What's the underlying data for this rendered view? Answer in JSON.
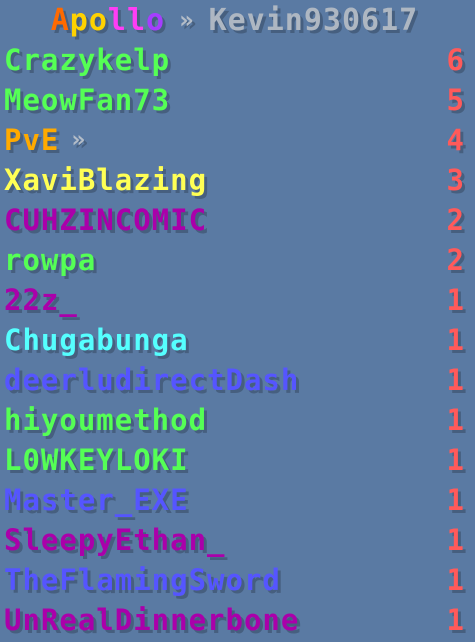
{
  "header": {
    "server": "Apollo",
    "separator": "»",
    "viewer": "Kevin930617",
    "server_gradient": [
      "#ff6a00",
      "#ffd200",
      "#ff3df5",
      "#a63dff"
    ]
  },
  "rows": [
    {
      "name": "Crazykelp",
      "score": "6",
      "color": "#55ff55"
    },
    {
      "name": "MeowFan73",
      "score": "5",
      "color": "#55ff55"
    },
    {
      "name": "PvE",
      "separator": "»",
      "score": "4",
      "color": "#ffaa00"
    },
    {
      "name": "XaviBlazing",
      "score": "3",
      "color": "#ffff55"
    },
    {
      "name": "CUHZINCOMIC",
      "score": "2",
      "color": "#aa00aa"
    },
    {
      "name": "rowpa",
      "score": "2",
      "color": "#55ff55"
    },
    {
      "name": "22z_",
      "score": "1",
      "color": "#aa00aa"
    },
    {
      "name": "Chugabunga",
      "score": "1",
      "color": "#55ffff"
    },
    {
      "name": "deerludirectDash",
      "score": "1",
      "color": "#5555ff"
    },
    {
      "name": "hiyoumethod",
      "score": "1",
      "color": "#55ff55"
    },
    {
      "name": "L0WKEYLOKI",
      "score": "1",
      "color": "#55ff55"
    },
    {
      "name": "Master_EXE",
      "score": "1",
      "color": "#5555ff"
    },
    {
      "name": "SleepyEthan_",
      "score": "1",
      "color": "#aa00aa"
    },
    {
      "name": "TheFlamingSword",
      "score": "1",
      "color": "#5555ff"
    },
    {
      "name": "UnRealDinnerbone",
      "score": "1",
      "color": "#aa00aa"
    }
  ],
  "score_color": "#ff5a5a"
}
